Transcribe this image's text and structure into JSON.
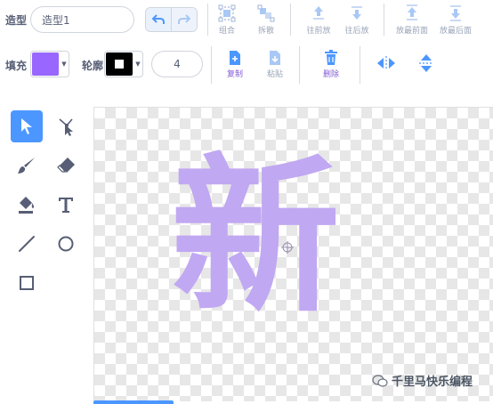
{
  "costume": {
    "label": "造型",
    "name": "造型1"
  },
  "history": {
    "undo_icon": "undo-icon",
    "redo_icon": "redo-icon"
  },
  "top_actions": [
    {
      "label": "组合",
      "icon": "group-icon"
    },
    {
      "label": "拆散",
      "icon": "ungroup-icon"
    },
    {
      "label": "往前放",
      "icon": "forward-icon"
    },
    {
      "label": "往后放",
      "icon": "backward-icon"
    },
    {
      "label": "放最前面",
      "icon": "front-icon"
    },
    {
      "label": "放最后面",
      "icon": "back-icon"
    }
  ],
  "fill": {
    "label": "填充",
    "color": "#9966ff"
  },
  "outline": {
    "label": "轮廓",
    "color": "#000000",
    "width": "4"
  },
  "edit_actions": [
    {
      "label": "复制",
      "icon": "copy-icon"
    },
    {
      "label": "粘贴",
      "icon": "paste-icon"
    },
    {
      "label": "删除",
      "icon": "delete-icon"
    }
  ],
  "flip": {
    "horizontal_icon": "flip-horizontal-icon",
    "vertical_icon": "flip-vertical-icon"
  },
  "tools": [
    {
      "name": "select",
      "icon": "arrow-icon",
      "active": true
    },
    {
      "name": "reshape",
      "icon": "reshape-icon",
      "active": false
    },
    {
      "name": "brush",
      "icon": "brush-icon",
      "active": false
    },
    {
      "name": "eraser",
      "icon": "eraser-icon",
      "active": false
    },
    {
      "name": "fill",
      "icon": "bucket-icon",
      "active": false
    },
    {
      "name": "text",
      "icon": "text-icon",
      "active": false
    },
    {
      "name": "line",
      "icon": "line-icon",
      "active": false
    },
    {
      "name": "circle",
      "icon": "circle-icon",
      "active": false
    },
    {
      "name": "rectangle",
      "icon": "rectangle-icon",
      "active": false
    }
  ],
  "canvas": {
    "glyph": "新",
    "glyph_color": "#c1a8f2"
  },
  "watermark": {
    "text": "千里马快乐编程"
  }
}
